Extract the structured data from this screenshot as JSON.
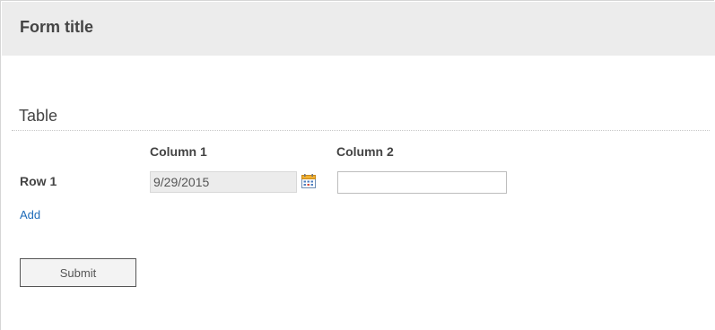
{
  "form": {
    "title": "Form title"
  },
  "section": {
    "title": "Table"
  },
  "table": {
    "columns": [
      "Column 1",
      "Column 2"
    ],
    "rows": [
      {
        "label": "Row 1",
        "column1_value": "9/29/2015",
        "column2_value": ""
      }
    ],
    "add_label": "Add"
  },
  "actions": {
    "submit_label": "Submit"
  },
  "icons": {
    "date_picker": "calendar-icon"
  },
  "colors": {
    "header_background": "#ececec",
    "link": "#1e6bb8",
    "text": "#444444",
    "readonly_input_background": "#ececec"
  }
}
